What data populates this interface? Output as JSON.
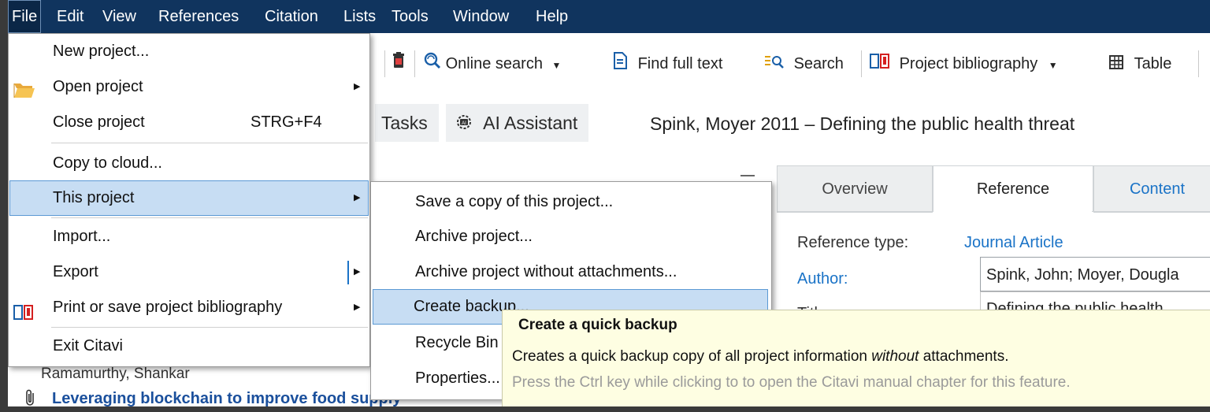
{
  "menubar": {
    "items": [
      "File",
      "Edit",
      "View",
      "References",
      "Citation",
      "Lists",
      "Tools",
      "Window",
      "Help"
    ]
  },
  "toolbar": {
    "online_search": "Online search",
    "find_full_text": "Find full text",
    "search": "Search",
    "project_bibliography": "Project bibliography",
    "table": "Table"
  },
  "second_row": {
    "tasks": "Tasks",
    "ai_assistant": "AI Assistant",
    "reference_title": "Spink, Moyer 2011 – Defining the public health threat"
  },
  "tabs": {
    "overview": "Overview",
    "reference": "Reference",
    "content": "Content"
  },
  "fields": {
    "reference_type_label": "Reference type:",
    "reference_type_value": "Journal Article",
    "author_label": "Author:",
    "author_value": "Spink, John; Moyer, Dougla",
    "title_label": "Title:",
    "title_value": "Defining the public health"
  },
  "left_list": {
    "partial_author": "Ramamurthy, Shankar",
    "item_title": "Leveraging blockchain to improve food supply"
  },
  "file_menu": {
    "new_project": "New project...",
    "open_project": "Open project",
    "close_project": "Close project",
    "close_project_shortcut": "STRG+F4",
    "copy_to_cloud": "Copy to cloud...",
    "this_project": "This project",
    "import": "Import...",
    "export": "Export",
    "print_bibliography": "Print or save project bibliography",
    "exit": "Exit Citavi"
  },
  "submenu": {
    "save_copy": "Save a copy of this project...",
    "archive": "Archive project...",
    "archive_no_attachments": "Archive project without attachments...",
    "create_backup": "Create backup...",
    "recycle_bin": "Recycle Bin",
    "properties": "Properties..."
  },
  "tooltip": {
    "title": "Create a quick backup",
    "line1_prefix": "Creates a quick backup copy of all project information ",
    "line1_em": "without",
    "line1_suffix": " attachments.",
    "line2": "Press the Ctrl key while clicking to to open the Citavi manual chapter for this feature."
  },
  "colors": {
    "menubar_bg": "#10345e",
    "highlight": "#c7ddf3",
    "link": "#1a73c7",
    "tooltip_bg": "#fefee2"
  }
}
